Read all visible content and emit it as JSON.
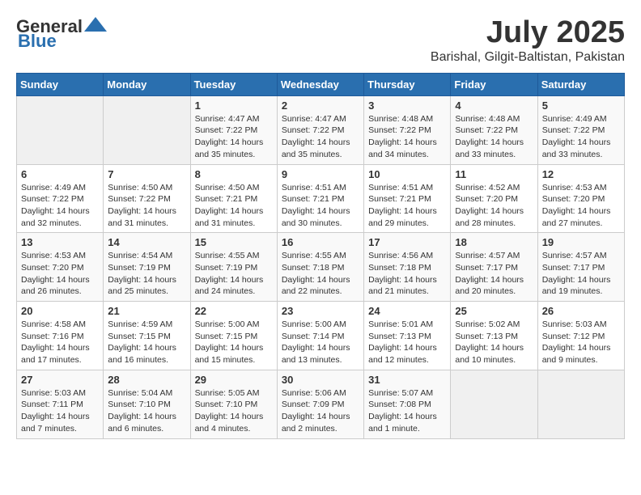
{
  "header": {
    "logo_general": "General",
    "logo_blue": "Blue",
    "month": "July 2025",
    "location": "Barishal, Gilgit-Baltistan, Pakistan"
  },
  "weekdays": [
    "Sunday",
    "Monday",
    "Tuesday",
    "Wednesday",
    "Thursday",
    "Friday",
    "Saturday"
  ],
  "weeks": [
    [
      {
        "day": "",
        "info": ""
      },
      {
        "day": "",
        "info": ""
      },
      {
        "day": "1",
        "info": "Sunrise: 4:47 AM\nSunset: 7:22 PM\nDaylight: 14 hours\nand 35 minutes."
      },
      {
        "day": "2",
        "info": "Sunrise: 4:47 AM\nSunset: 7:22 PM\nDaylight: 14 hours\nand 35 minutes."
      },
      {
        "day": "3",
        "info": "Sunrise: 4:48 AM\nSunset: 7:22 PM\nDaylight: 14 hours\nand 34 minutes."
      },
      {
        "day": "4",
        "info": "Sunrise: 4:48 AM\nSunset: 7:22 PM\nDaylight: 14 hours\nand 33 minutes."
      },
      {
        "day": "5",
        "info": "Sunrise: 4:49 AM\nSunset: 7:22 PM\nDaylight: 14 hours\nand 33 minutes."
      }
    ],
    [
      {
        "day": "6",
        "info": "Sunrise: 4:49 AM\nSunset: 7:22 PM\nDaylight: 14 hours\nand 32 minutes."
      },
      {
        "day": "7",
        "info": "Sunrise: 4:50 AM\nSunset: 7:22 PM\nDaylight: 14 hours\nand 31 minutes."
      },
      {
        "day": "8",
        "info": "Sunrise: 4:50 AM\nSunset: 7:21 PM\nDaylight: 14 hours\nand 31 minutes."
      },
      {
        "day": "9",
        "info": "Sunrise: 4:51 AM\nSunset: 7:21 PM\nDaylight: 14 hours\nand 30 minutes."
      },
      {
        "day": "10",
        "info": "Sunrise: 4:51 AM\nSunset: 7:21 PM\nDaylight: 14 hours\nand 29 minutes."
      },
      {
        "day": "11",
        "info": "Sunrise: 4:52 AM\nSunset: 7:20 PM\nDaylight: 14 hours\nand 28 minutes."
      },
      {
        "day": "12",
        "info": "Sunrise: 4:53 AM\nSunset: 7:20 PM\nDaylight: 14 hours\nand 27 minutes."
      }
    ],
    [
      {
        "day": "13",
        "info": "Sunrise: 4:53 AM\nSunset: 7:20 PM\nDaylight: 14 hours\nand 26 minutes."
      },
      {
        "day": "14",
        "info": "Sunrise: 4:54 AM\nSunset: 7:19 PM\nDaylight: 14 hours\nand 25 minutes."
      },
      {
        "day": "15",
        "info": "Sunrise: 4:55 AM\nSunset: 7:19 PM\nDaylight: 14 hours\nand 24 minutes."
      },
      {
        "day": "16",
        "info": "Sunrise: 4:55 AM\nSunset: 7:18 PM\nDaylight: 14 hours\nand 22 minutes."
      },
      {
        "day": "17",
        "info": "Sunrise: 4:56 AM\nSunset: 7:18 PM\nDaylight: 14 hours\nand 21 minutes."
      },
      {
        "day": "18",
        "info": "Sunrise: 4:57 AM\nSunset: 7:17 PM\nDaylight: 14 hours\nand 20 minutes."
      },
      {
        "day": "19",
        "info": "Sunrise: 4:57 AM\nSunset: 7:17 PM\nDaylight: 14 hours\nand 19 minutes."
      }
    ],
    [
      {
        "day": "20",
        "info": "Sunrise: 4:58 AM\nSunset: 7:16 PM\nDaylight: 14 hours\nand 17 minutes."
      },
      {
        "day": "21",
        "info": "Sunrise: 4:59 AM\nSunset: 7:15 PM\nDaylight: 14 hours\nand 16 minutes."
      },
      {
        "day": "22",
        "info": "Sunrise: 5:00 AM\nSunset: 7:15 PM\nDaylight: 14 hours\nand 15 minutes."
      },
      {
        "day": "23",
        "info": "Sunrise: 5:00 AM\nSunset: 7:14 PM\nDaylight: 14 hours\nand 13 minutes."
      },
      {
        "day": "24",
        "info": "Sunrise: 5:01 AM\nSunset: 7:13 PM\nDaylight: 14 hours\nand 12 minutes."
      },
      {
        "day": "25",
        "info": "Sunrise: 5:02 AM\nSunset: 7:13 PM\nDaylight: 14 hours\nand 10 minutes."
      },
      {
        "day": "26",
        "info": "Sunrise: 5:03 AM\nSunset: 7:12 PM\nDaylight: 14 hours\nand 9 minutes."
      }
    ],
    [
      {
        "day": "27",
        "info": "Sunrise: 5:03 AM\nSunset: 7:11 PM\nDaylight: 14 hours\nand 7 minutes."
      },
      {
        "day": "28",
        "info": "Sunrise: 5:04 AM\nSunset: 7:10 PM\nDaylight: 14 hours\nand 6 minutes."
      },
      {
        "day": "29",
        "info": "Sunrise: 5:05 AM\nSunset: 7:10 PM\nDaylight: 14 hours\nand 4 minutes."
      },
      {
        "day": "30",
        "info": "Sunrise: 5:06 AM\nSunset: 7:09 PM\nDaylight: 14 hours\nand 2 minutes."
      },
      {
        "day": "31",
        "info": "Sunrise: 5:07 AM\nSunset: 7:08 PM\nDaylight: 14 hours\nand 1 minute."
      },
      {
        "day": "",
        "info": ""
      },
      {
        "day": "",
        "info": ""
      }
    ]
  ]
}
